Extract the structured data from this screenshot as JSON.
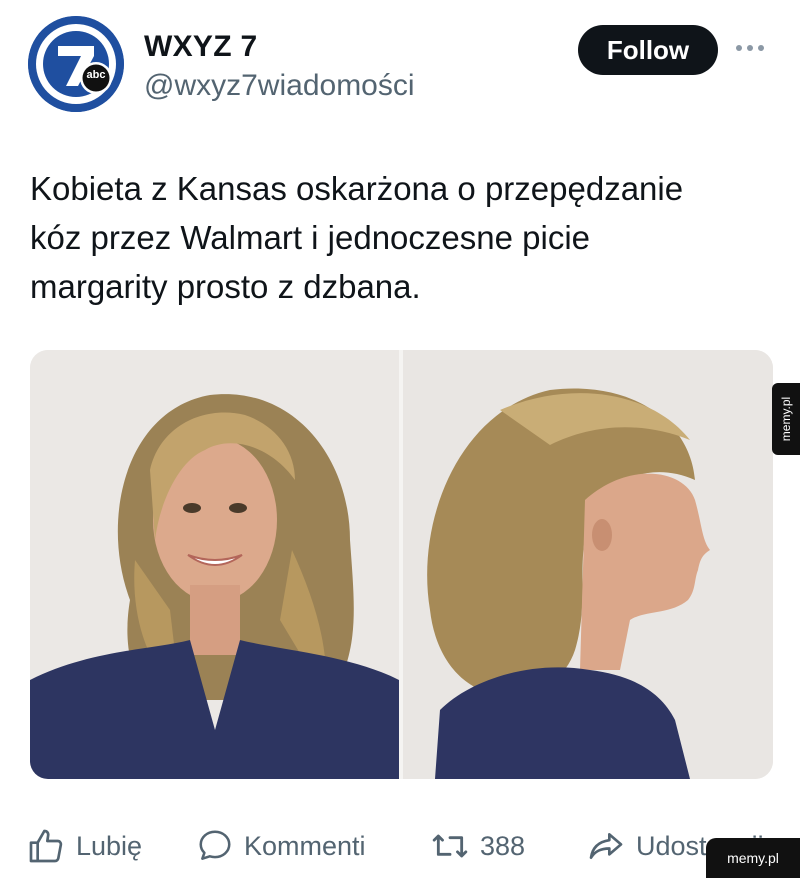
{
  "account": {
    "display_name": "WXYZ 7",
    "handle": "@wxyz7wiadomości",
    "logo_text": "abc",
    "logo_number": "7"
  },
  "follow_label": "Follow",
  "tweet": {
    "lines": [
      "Kobieta z Kansas oskarżona o przepędzanie",
      "kóz przez Walmart i jednoczesne picie",
      "margarity prosto z dzbana."
    ]
  },
  "media": {
    "description_icon": "mugshot-photo-icon"
  },
  "actions": {
    "like_label": "Lubię",
    "comment_label": "Kommenti",
    "retweet_count": "388",
    "share_label": "Udostępnij"
  },
  "watermarks": {
    "side": "memy.pl",
    "bottom": "memy.pl"
  },
  "colors": {
    "follow_bg": "#0f1419",
    "muted": "#536471",
    "logo_blue": "#1f4fa0"
  }
}
